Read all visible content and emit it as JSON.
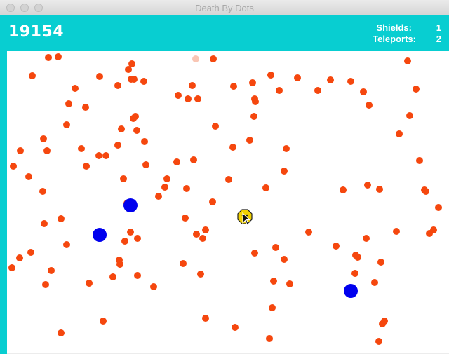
{
  "window": {
    "title": "Death By Dots"
  },
  "hud": {
    "score": "19154",
    "shields_label": "Shields:",
    "shields_value": "1",
    "teleports_label": "Teleports:",
    "teleports_value": "2"
  },
  "colors": {
    "hud": "#08ced1",
    "enemy_dot": "#f5470e",
    "faded_dot": "#f9c6b4",
    "powerup": "#0000ee",
    "player": "#f2d200"
  },
  "icons": {
    "player": "smiley-face-icon",
    "cursor": "mouse-pointer-icon"
  }
}
